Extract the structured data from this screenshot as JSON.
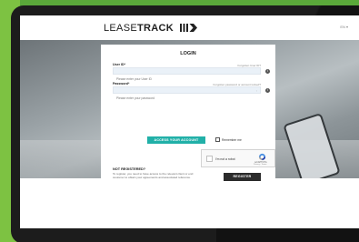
{
  "brand": {
    "logo_light": "LEASE",
    "logo_bold": "TRACK"
  },
  "header": {
    "language": "EN ▾"
  },
  "login": {
    "title": "LOGIN",
    "user_id_label": "User ID*",
    "forgot_user_id": "Forgotten User ID?",
    "user_id_placeholder": "Please enter your User ID",
    "password_label": "Password*",
    "forgot_password": "Forgotten password or account locked?",
    "password_placeholder": "Please enter your password",
    "access_button": "ACCESS YOUR ACCOUNT",
    "remember_me": "Remember me"
  },
  "captcha": {
    "label": "I'm not a robot",
    "brand": "reCAPTCHA",
    "links": "Privacy - Terms"
  },
  "register": {
    "heading": "NOT REGISTERED?",
    "text": "To register, you need to have access to the relevant client or end customer to obtain your agreements and associated reference.",
    "button": "REGISTER"
  },
  "colors": {
    "accent": "#21b0a8",
    "frame_green": "#5aa83a",
    "register_bg": "#2b2b2b"
  }
}
